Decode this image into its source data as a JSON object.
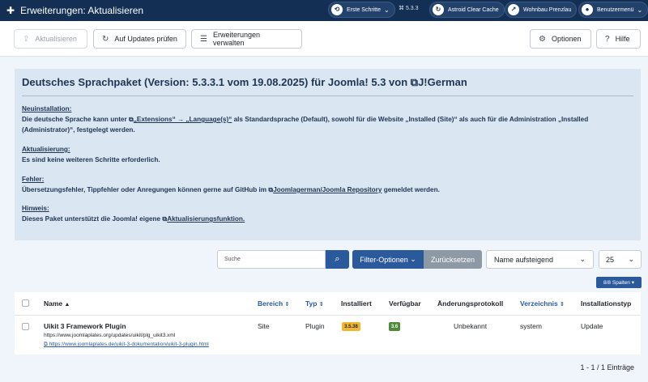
{
  "header": {
    "title": "Erweiterungen: Aktualisieren",
    "first_steps": "Erste Schritte",
    "version": "5.3.3",
    "cache_label": "Astroid Clear Cache",
    "site_label": "Wohnbau Prenzlau",
    "user_label": "Benutzermenü"
  },
  "toolbar": {
    "update": "Aktualisieren",
    "check": "Auf Updates prüfen",
    "manage": "Erweiterungen verwalten",
    "options": "Optionen",
    "help": "Hilfe"
  },
  "info": {
    "title_prefix": "Deutsches Sprachpaket (Version: 5.3.3.1 vom 19.08.2025) für Joomla! 5.3 von",
    "title_link": "J!German",
    "install_head": "Neuinstallation:",
    "install_text_1": "Die deutsche Sprache kann unter",
    "install_link_1": "„Extensions“ → „Language(s)“",
    "install_text_2": "als Standardsprache (Default), sowohl für die Website „Installed (Site)“ als auch für die Administration „Installed (Administrator)“, festgelegt werden.",
    "update_head": "Aktualisierung:",
    "update_text": "Es sind keine weiteren Schritte erforderlich.",
    "error_head": "Fehler:",
    "error_text_1": "Übersetzungsfehler, Tippfehler oder Anregungen können gerne auf GitHub im",
    "error_link": "Joomlagerman/Joomla Repository",
    "error_text_2": "gemeldet werden.",
    "hint_head": "Hinweis:",
    "hint_text_1": "Dieses Paket unterstützt die Joomla! eigene",
    "hint_link": "Aktualisierungsfunktion."
  },
  "filters": {
    "search_placeholder": "Suche",
    "filter_options": "Filter-Optionen",
    "reset": "Zurücksetzen",
    "sort": "Name aufsteigend",
    "limit": "25",
    "columns": "8/8 Spalten"
  },
  "table": {
    "headers": {
      "name": "Name",
      "area": "Bereich",
      "type": "Typ",
      "installed": "Installiert",
      "available": "Verfügbar",
      "changelog": "Änderungsprotokoll",
      "directory": "Verzeichnis",
      "install_type": "Installationstyp"
    },
    "rows": [
      {
        "name": "Uikit 3 Framework Plugin",
        "update_url": "https://www.joomlaplates.org/updates/uikit/plg_uikit3.xml",
        "info_url": "https://www.joomlaplates.de/uikit-3-dokumentation/uikit-3-plugin.html",
        "area": "Site",
        "type": "Plugin",
        "installed": "3.5.38",
        "available": "3.6",
        "changelog": "Unbekannt",
        "directory": "system",
        "install_type": "Update"
      }
    ]
  },
  "pagination": {
    "count": "1 - 1 / 1 Einträge"
  }
}
